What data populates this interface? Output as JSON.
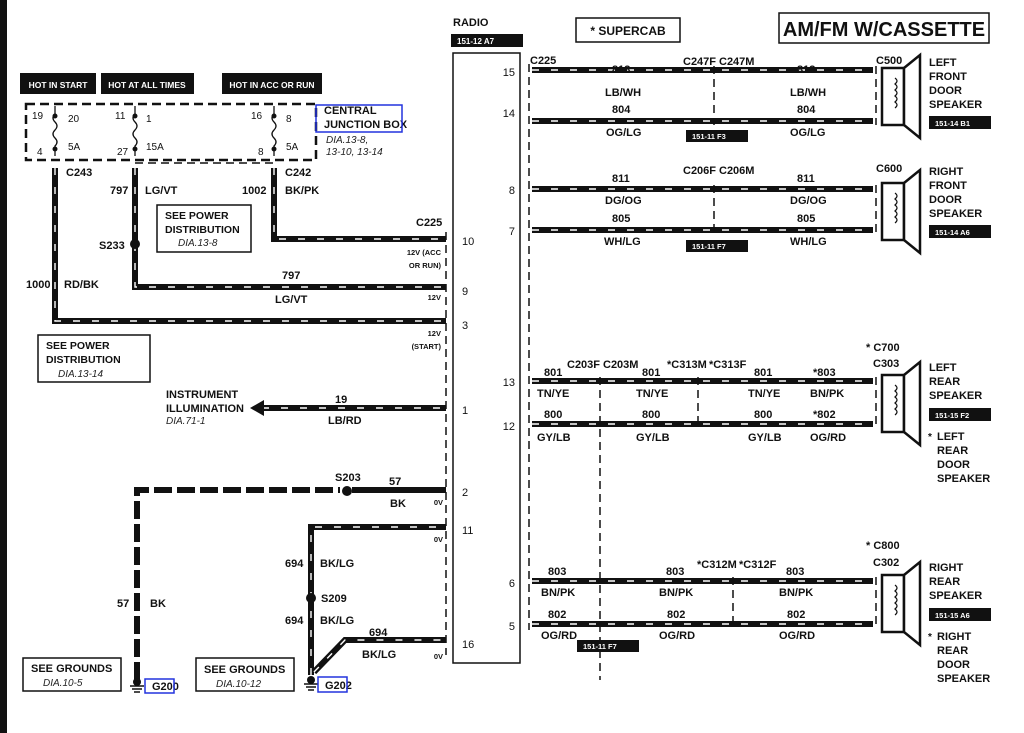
{
  "title": "AM/FM W/CASSETTE",
  "supercab_note": "* SUPERCAB",
  "radio": {
    "label": "RADIO",
    "ref": "151-12 A7"
  },
  "power_tags": [
    "HOT IN START",
    "HOT AT ALL TIMES",
    "HOT IN ACC OR RUN"
  ],
  "junction_box": {
    "name_line1": "CENTRAL",
    "name_line2": "JUNCTION BOX",
    "dia_line1": "DIA.13-8,",
    "dia_line2": "13-10, 13-14",
    "fuses": [
      {
        "in_pin": "19",
        "fuse": "20",
        "out_pin": "4",
        "rating": "5A"
      },
      {
        "in_pin": "11",
        "fuse": "1",
        "out_pin": "27",
        "rating": "15A"
      },
      {
        "in_pin": "16",
        "fuse": "8",
        "out_pin": "8",
        "rating": "5A"
      }
    ]
  },
  "left": {
    "c243": "C243",
    "c242": "C242",
    "w797": "797",
    "lgvt": "LG/VT",
    "w1002": "1002",
    "bkpk": "BK/PK",
    "w1000": "1000",
    "rdbk": "RD/BK",
    "s233": "S233",
    "c225": "C225",
    "see_power1": {
      "l1": "SEE POWER",
      "l2": "DISTRIBUTION",
      "l3": "DIA.13-8"
    },
    "see_power2": {
      "l1": "SEE POWER",
      "l2": "DISTRIBUTION",
      "l3": "DIA.13-14"
    },
    "w797b": "797",
    "lgvt_b": "LG/VT",
    "v10a": "12V (ACC",
    "v10b": "OR RUN)",
    "v9": "12V",
    "v3a": "12V",
    "v3b": "(START)",
    "instr1": "INSTRUMENT",
    "instr2": "ILLUMINATION",
    "instr_dia": "DIA.71-1",
    "w19": "19",
    "lbrd": "LB/RD",
    "s203": "S203",
    "w57": "57",
    "bk": "BK",
    "v2": "0V",
    "v11": "0V",
    "w694a": "694",
    "bklg_a": "BK/LG",
    "s209": "S209",
    "w694b": "694",
    "bklg_b": "BK/LG",
    "w694c": "694",
    "bklg_c": "BK/LG",
    "v16": "0V",
    "w57b": "57",
    "bk_b": "BK",
    "grounds1": {
      "l1": "SEE GROUNDS",
      "l2": "DIA.10-5",
      "g": "G200"
    },
    "grounds2": {
      "l1": "SEE GROUNDS",
      "l2": "DIA.10-12",
      "g": "G202"
    }
  },
  "radio_pins_left": [
    "10",
    "9",
    "3",
    "1",
    "2",
    "11",
    "16"
  ],
  "radio_pins_right": [
    "15",
    "14",
    "8",
    "7",
    "13",
    "12",
    "6",
    "5"
  ],
  "right": {
    "c225": "C225",
    "lf": {
      "conn1": "C247F",
      "conn2": "C247M",
      "w_a": "813",
      "c_a": "LB/WH",
      "w_b": "804",
      "c_b": "OG/LG",
      "ref": "151-11 F3",
      "spk_conn": "C500",
      "spk": [
        "LEFT",
        "FRONT",
        "DOOR",
        "SPEAKER"
      ],
      "spk_ref": "151-14 B1"
    },
    "rf": {
      "conn1": "C206F",
      "conn2": "C206M",
      "w_a": "811",
      "c_a": "DG/OG",
      "w_b": "805",
      "c_b": "WH/LG",
      "ref": "151-11 F7",
      "spk_conn": "C600",
      "spk": [
        "RIGHT",
        "FRONT",
        "DOOR",
        "SPEAKER"
      ],
      "spk_ref": "151-14 A6"
    },
    "lr": {
      "conn1": "C203F",
      "conn2": "C203M",
      "conn3": "*C313M",
      "conn4": "*C313F",
      "w_a": "801",
      "c_a": "TN/YE",
      "w_a2": "*803",
      "c_a2": "BN/PK",
      "w_b": "800",
      "c_b": "GY/LB",
      "w_b2": "*802",
      "c_b2": "OG/RD",
      "spk_conn_alt": "* C700",
      "spk_conn": "C303",
      "spk": [
        "LEFT",
        "REAR",
        "SPEAKER"
      ],
      "spk_ref": "151-15 F2",
      "alt": [
        "LEFT",
        "REAR",
        "DOOR",
        "SPEAKER"
      ]
    },
    "rr": {
      "conn3": "*C312M",
      "conn4": "*C312F",
      "w_a": "803",
      "c_a": "BN/PK",
      "w_b": "802",
      "c_b": "OG/RD",
      "ref": "151-11 F7",
      "spk_conn_alt": "* C800",
      "spk_conn": "C302",
      "spk": [
        "RIGHT",
        "REAR",
        "SPEAKER"
      ],
      "spk_ref": "151-15 A6",
      "alt": [
        "RIGHT",
        "REAR",
        "DOOR",
        "SPEAKER"
      ]
    }
  }
}
